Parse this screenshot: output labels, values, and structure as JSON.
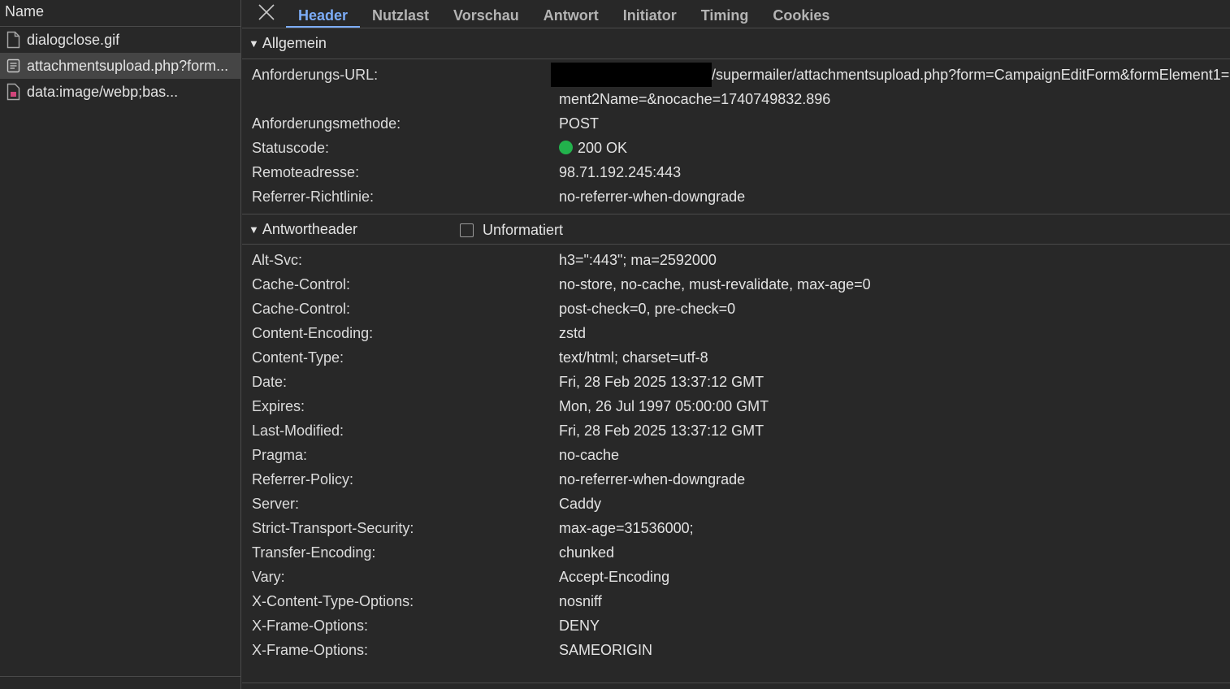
{
  "left_panel": {
    "column_header": "Name",
    "requests": [
      {
        "name": "dialogclose.gif",
        "icon": "file-icon",
        "selected": false
      },
      {
        "name": "attachmentsupload.php?form...",
        "icon": "document-icon",
        "selected": true
      },
      {
        "name": "data:image/webp;bas...",
        "icon": "image-icon",
        "selected": false
      }
    ]
  },
  "tabs": [
    "Header",
    "Nutzlast",
    "Vorschau",
    "Antwort",
    "Initiator",
    "Timing",
    "Cookies"
  ],
  "active_tab": "Header",
  "general": {
    "title": "Allgemein",
    "url_label": "Anforderungs-URL:",
    "url_value": "/supermailer/attachmentsupload.php?form=CampaignEditForm&formElement1=",
    "url_cont": "ment2Name=&nocache=1740749832.896",
    "rows": [
      {
        "key": "Anforderungsmethode:",
        "value": "POST"
      },
      {
        "key": "Statuscode:",
        "value": "200 OK"
      },
      {
        "key": "Remoteadresse:",
        "value": "98.71.192.245:443"
      },
      {
        "key": "Referrer-Richtlinie:",
        "value": "no-referrer-when-downgrade"
      }
    ],
    "status_color": "#22b24c"
  },
  "response": {
    "title": "Antwortheader",
    "raw_label": "Unformatiert",
    "rows": [
      {
        "key": "Alt-Svc:",
        "value": "h3=\":443\"; ma=2592000"
      },
      {
        "key": "Cache-Control:",
        "value": "no-store, no-cache, must-revalidate, max-age=0"
      },
      {
        "key": "Cache-Control:",
        "value": "post-check=0, pre-check=0"
      },
      {
        "key": "Content-Encoding:",
        "value": "zstd"
      },
      {
        "key": "Content-Type:",
        "value": "text/html; charset=utf-8"
      },
      {
        "key": "Date:",
        "value": "Fri, 28 Feb 2025 13:37:12 GMT"
      },
      {
        "key": "Expires:",
        "value": "Mon, 26 Jul 1997 05:00:00 GMT"
      },
      {
        "key": "Last-Modified:",
        "value": "Fri, 28 Feb 2025 13:37:12 GMT"
      },
      {
        "key": "Pragma:",
        "value": "no-cache"
      },
      {
        "key": "Referrer-Policy:",
        "value": "no-referrer-when-downgrade"
      },
      {
        "key": "Server:",
        "value": "Caddy"
      },
      {
        "key": "Strict-Transport-Security:",
        "value": "max-age=31536000;"
      },
      {
        "key": "Transfer-Encoding:",
        "value": "chunked"
      },
      {
        "key": "Vary:",
        "value": "Accept-Encoding"
      },
      {
        "key": "X-Content-Type-Options:",
        "value": "nosniff"
      },
      {
        "key": "X-Frame-Options:",
        "value": "DENY"
      },
      {
        "key": "X-Frame-Options:",
        "value": "SAMEORIGIN"
      }
    ]
  }
}
